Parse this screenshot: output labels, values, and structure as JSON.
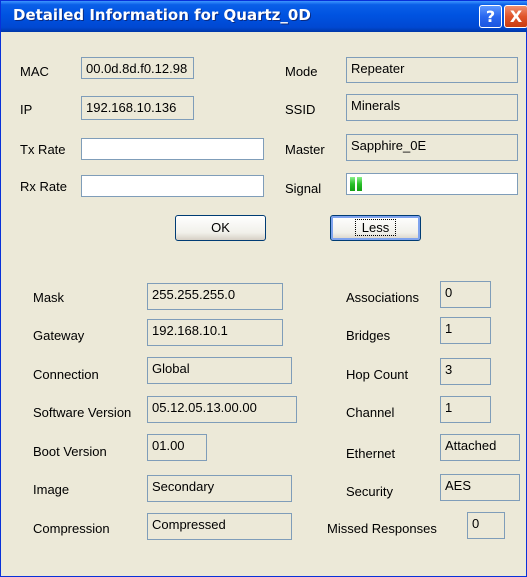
{
  "window": {
    "title": "Detailed Information for Quartz_0D",
    "help_glyph": "?",
    "close_glyph": "X"
  },
  "top": {
    "mac_label": "MAC",
    "mac_value": "00.0d.8d.f0.12.98",
    "ip_label": "IP",
    "ip_value": "192.168.10.136",
    "tx_label": "Tx Rate",
    "tx_value": "",
    "rx_label": "Rx Rate",
    "rx_value": "",
    "mode_label": "Mode",
    "mode_value": "Repeater",
    "ssid_label": "SSID",
    "ssid_value": "Minerals",
    "master_label": "Master",
    "master_value": "Sapphire_0E",
    "signal_label": "Signal",
    "signal_bars_shown": 2,
    "signal_color": "#28c028"
  },
  "buttons": {
    "ok": "OK",
    "less": "Less"
  },
  "details_left": [
    {
      "label": "Mask",
      "value": "255.255.255.0"
    },
    {
      "label": "Gateway",
      "value": "192.168.10.1"
    },
    {
      "label": "Connection",
      "value": "Global"
    },
    {
      "label": "Software Version",
      "value": "05.12.05.13.00.00"
    },
    {
      "label": "Boot Version",
      "value": "01.00"
    },
    {
      "label": "Image",
      "value": "Secondary"
    },
    {
      "label": "Compression",
      "value": "Compressed"
    }
  ],
  "details_right": [
    {
      "label": "Associations",
      "value": "0"
    },
    {
      "label": "Bridges",
      "value": "1"
    },
    {
      "label": "Hop Count",
      "value": "3"
    },
    {
      "label": "Channel",
      "value": "1"
    },
    {
      "label": "Ethernet",
      "value": "Attached"
    },
    {
      "label": "Security",
      "value": "AES"
    },
    {
      "label": "Missed Responses",
      "value": "0"
    }
  ],
  "colors": {
    "titlebar": "#0053e1",
    "window_bg": "#ece9d8",
    "field_border": "#7f9db9",
    "close_button": "#e0542a"
  }
}
